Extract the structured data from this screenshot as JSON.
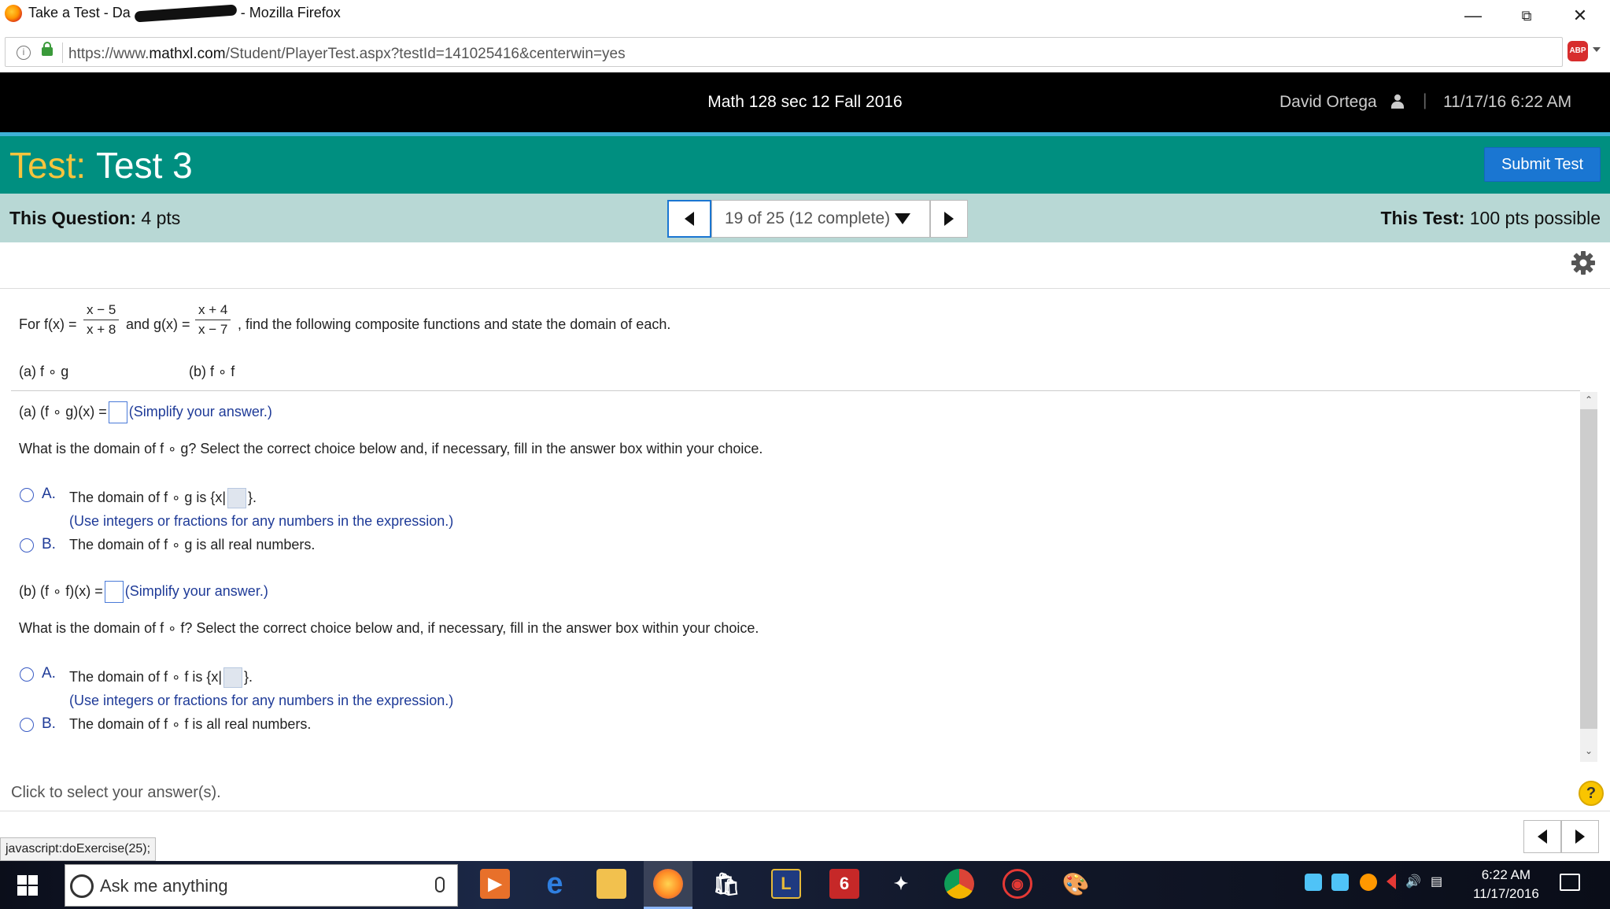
{
  "browser": {
    "window_title": "Take a Test - David Ortega - Mozilla Firefox",
    "window_title_visible": "Take a Test - Da",
    "window_title_suffix": "- Mozilla Firefox",
    "url_prefix": "https://www.",
    "url_domain": "mathxl.com",
    "url_path": "/Student/PlayerTest.aspx?testId=141025416&centerwin=yes",
    "abp_label": "ABP",
    "minimize_icon": "minimize-icon",
    "restore_icon": "restore-icon",
    "close_icon": "close-icon"
  },
  "course_header": {
    "course_name": "Math 128 sec 12 Fall 2016",
    "user_name": "David Ortega",
    "separator": "|",
    "datetime": "11/17/16 6:22 AM"
  },
  "test_header": {
    "label": "Test:",
    "name": "Test 3",
    "submit_label": "Submit Test"
  },
  "question_bar": {
    "this_question_label": "This Question:",
    "this_question_value": "4 pts",
    "selector_text": "19 of 25 (12 complete)",
    "this_test_label": "This Test:",
    "this_test_value": "100 pts possible"
  },
  "problem": {
    "for_text": "For f(x) =",
    "f_num": "x − 5",
    "f_den": "x + 8",
    "and_text": "and g(x) =",
    "g_num": "x + 4",
    "g_den": "x − 7",
    "rest_text": ", find the following composite functions and state the domain of each.",
    "part_a": "(a) f ∘ g",
    "part_b": "(b) f ∘ f"
  },
  "answers": {
    "a_prefix": "(a)  (f ∘ g)(x) =",
    "simplify": "(Simplify your answer.)",
    "a_domain_question": "What is the domain of f ∘ g? Select the correct choice below and, if necessary, fill in the answer box within your choice.",
    "a_options": [
      {
        "letter": "A.",
        "text_before": "The domain of f ∘ g is {x|",
        "text_after": "}.",
        "hint": "(Use integers or fractions for any numbers in the expression.)"
      },
      {
        "letter": "B.",
        "text": "The domain of f ∘ g is all real numbers."
      }
    ],
    "b_prefix": "(b)  (f ∘ f)(x) =",
    "b_domain_question": "What is the domain of f ∘ f? Select the correct choice below and, if necessary, fill in the answer box within your choice.",
    "b_options": [
      {
        "letter": "A.",
        "text_before": "The domain of f ∘ f is {x|",
        "text_after": "}.",
        "hint": "(Use integers or fractions for any numbers in the expression.)"
      },
      {
        "letter": "B.",
        "text": "The domain of f ∘ f is all real numbers."
      }
    ]
  },
  "footer": {
    "hint": "Click to select your answer(s).",
    "help_label": "?",
    "status_text": "javascript:doExercise(25);"
  },
  "taskbar": {
    "search_placeholder": "Ask me anything",
    "clock_time": "6:22 AM",
    "clock_date": "11/17/2016"
  }
}
